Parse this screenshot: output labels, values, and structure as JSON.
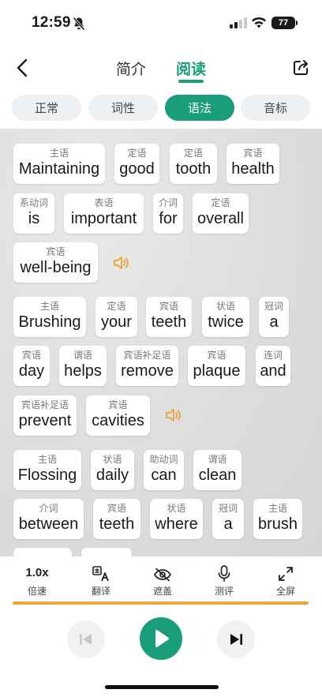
{
  "status": {
    "time": "12:59",
    "battery": "77"
  },
  "nav": {
    "tabs": [
      "简介",
      "阅读"
    ]
  },
  "modes": [
    "正常",
    "词性",
    "语法",
    "音标"
  ],
  "rows": [
    [
      {
        "tag": "主语",
        "word": "Maintaining"
      },
      {
        "tag": "定语",
        "word": "good"
      },
      {
        "tag": "定语",
        "word": "tooth"
      },
      {
        "tag": "宾语",
        "word": "health"
      }
    ],
    [
      {
        "tag": "系动词",
        "word": "is"
      },
      {
        "tag": "表语",
        "word": "important"
      },
      {
        "tag": "介词",
        "word": "for"
      },
      {
        "tag": "定语",
        "word": "overall"
      }
    ],
    [
      {
        "tag": "宾语",
        "word": "well-being"
      }
    ],
    [
      {
        "tag": "主语",
        "word": "Brushing"
      },
      {
        "tag": "定语",
        "word": "your"
      },
      {
        "tag": "宾语",
        "word": "teeth"
      },
      {
        "tag": "状语",
        "word": "twice"
      },
      {
        "tag": "冠词",
        "word": "a"
      }
    ],
    [
      {
        "tag": "宾语",
        "word": "day"
      },
      {
        "tag": "谓语",
        "word": "helps"
      },
      {
        "tag": "宾语补足语",
        "word": "remove"
      },
      {
        "tag": "宾语",
        "word": "plaque"
      },
      {
        "tag": "连词",
        "word": "and"
      }
    ],
    [
      {
        "tag": "宾语补足语",
        "word": "prevent"
      },
      {
        "tag": "宾语",
        "word": "cavities"
      }
    ],
    [
      {
        "tag": "主语",
        "word": "Flossing"
      },
      {
        "tag": "状语",
        "word": "daily"
      },
      {
        "tag": "助动词",
        "word": "can"
      },
      {
        "tag": "谓语",
        "word": "clean"
      }
    ],
    [
      {
        "tag": "介词",
        "word": "between"
      },
      {
        "tag": "宾语",
        "word": "teeth"
      },
      {
        "tag": "状语",
        "word": "where"
      },
      {
        "tag": "冠词",
        "word": "a"
      },
      {
        "tag": "主语",
        "word": "brush"
      }
    ],
    [
      {
        "tag": "",
        "word": ""
      },
      {
        "tag": "",
        "word": ""
      }
    ]
  ],
  "toolbar": {
    "speed_value": "1.0x",
    "items": [
      "倍速",
      "翻译",
      "遮盖",
      "测评",
      "全屏"
    ]
  },
  "player": {
    "progress": 1.0
  },
  "colors": {
    "accent": "#1a9d7a",
    "progress": "#efa53a",
    "speaker": "#e8a13a"
  },
  "icons": [
    "bell-off-icon",
    "signal-icon",
    "wifi-icon",
    "battery-icon",
    "back-icon",
    "share-icon",
    "speaker-icon",
    "translate-icon",
    "eye-off-icon",
    "microphone-icon",
    "fullscreen-icon",
    "skip-previous-icon",
    "play-icon",
    "skip-next-icon"
  ]
}
